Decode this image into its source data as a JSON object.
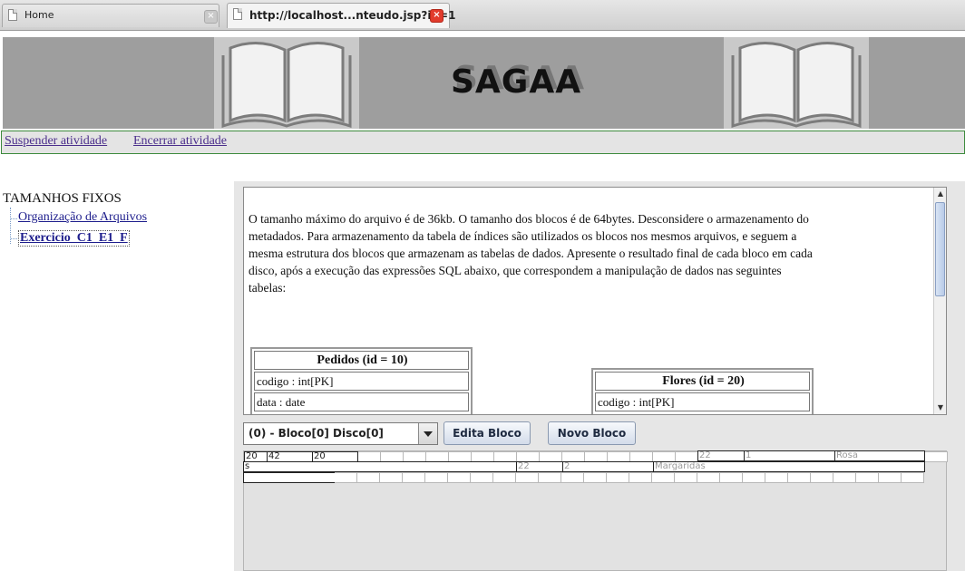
{
  "browser": {
    "tabs": [
      {
        "label": "Home",
        "active": false
      },
      {
        "label": "http://localhost...nteudo.jsp?id=1",
        "active": true
      }
    ]
  },
  "banner": {
    "logo": "SAGAA"
  },
  "actions": {
    "suspend": "Suspender atividade",
    "end": "Encerrar atividade"
  },
  "tree": {
    "root": "TAMANHOS FIXOS",
    "items": [
      "Organização de Arquivos",
      "Exercicio_C1_E1_F"
    ]
  },
  "content": {
    "paragraph": "O tamanho máximo do arquivo é de 36kb. O tamanho dos blocos é de 64bytes. Desconsidere o armazenamento do metadados. Para armazenamento da tabela de índices são utilizados os blocos nos mesmos arquivos, e seguem a mesma estrutura dos blocos que armazenam as tabelas de dados. Apresente o resultado final de cada bloco em cada disco, após a execução das expressões SQL abaixo, que correspondem a manipulação de dados nas seguintes tabelas:",
    "tables": [
      {
        "title": "Pedidos (id = 10)",
        "fields": [
          "codigo : int[PK]",
          "data : date"
        ]
      },
      {
        "title": "Flores (id = 20)",
        "fields": [
          "codigo : int[PK]"
        ]
      }
    ]
  },
  "controls": {
    "block_select": "(0) - Bloco[0] Disco[0]",
    "edit_button": "Edita Bloco",
    "new_button": "Novo Bloco"
  },
  "grid": {
    "row1": [
      "20",
      "42",
      "20",
      "22",
      "1",
      "Rosa"
    ],
    "row2": [
      "s",
      "22",
      "2",
      "Margaridas"
    ]
  },
  "colors": {
    "accent_border": "#3c8a3c",
    "link": "#4b2e8c",
    "close_tab": "#e23b2c"
  }
}
